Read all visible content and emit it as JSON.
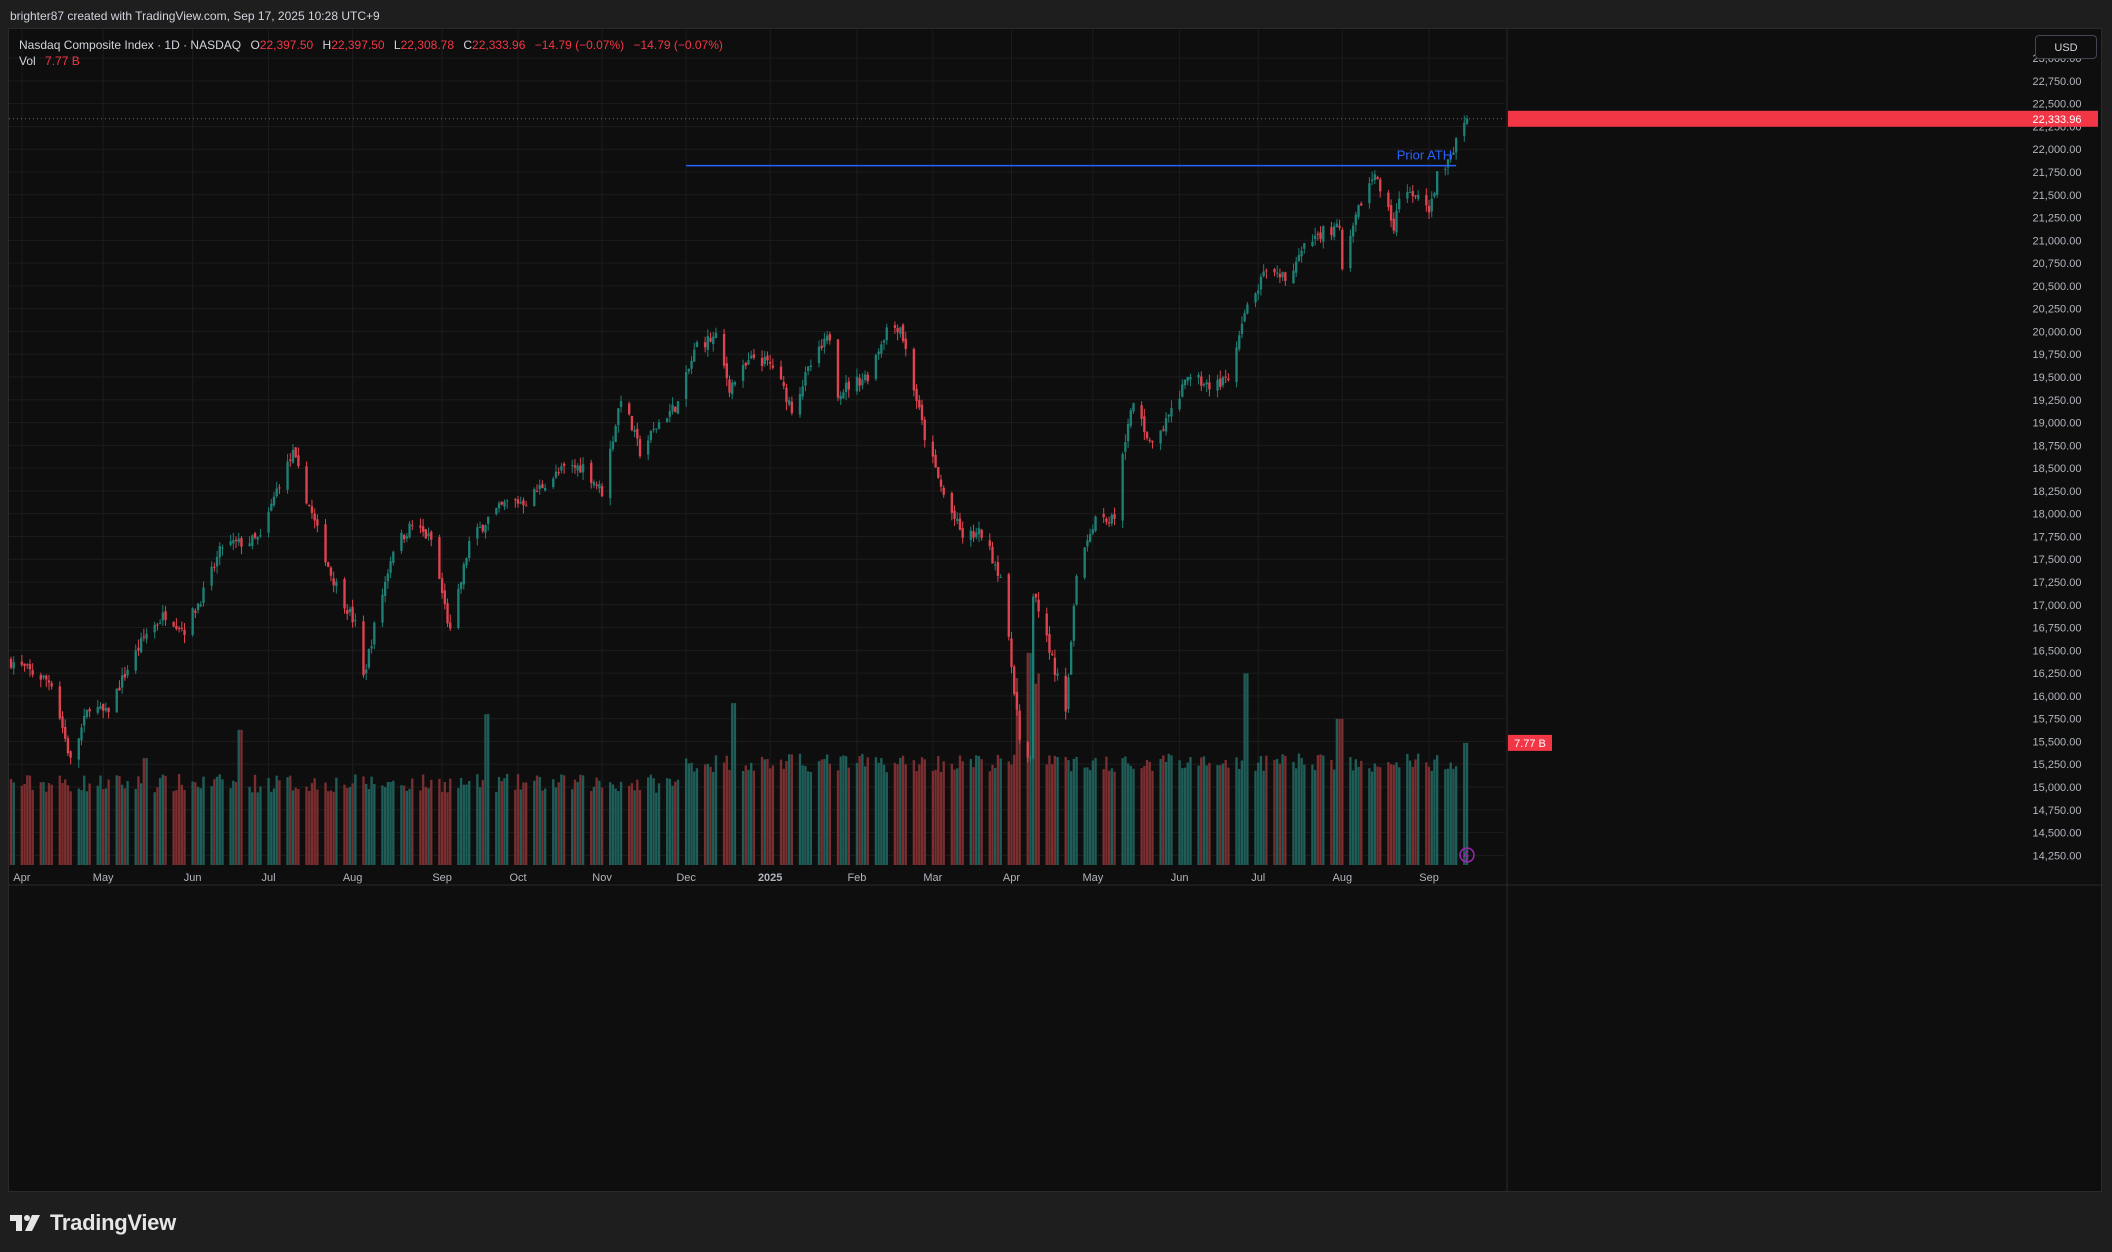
{
  "header": {
    "attribution": "brighter87 created with TradingView.com, Sep 17, 2025 10:28 UTC+9"
  },
  "legend": {
    "symbol": "Nasdaq Composite Index · 1D · NASDAQ",
    "o_label": "O",
    "o_value": "22,397.50",
    "h_label": "H",
    "h_value": "22,397.50",
    "l_label": "L",
    "l_value": "22,308.78",
    "c_label": "C",
    "c_value": "22,333.96",
    "change": "−14.79 (−0.07%)",
    "change_repeat": "−14.79 (−0.07%)",
    "vol_label": "Vol",
    "vol_value": "7.77 B"
  },
  "currency_button": "USD",
  "footer": {
    "logo_text": "TradingView"
  },
  "colors": {
    "up": "#1e7f74",
    "down": "#e04350",
    "vol_up": "#1f5e58",
    "vol_down": "#7a2e30",
    "line": "#2962ff",
    "price_tag": "#f23645",
    "annotation": "#2962ff"
  },
  "chart_data": {
    "type": "candlestick",
    "title": "Nasdaq Composite Index · 1D · NASDAQ",
    "ylim": [
      14100,
      23100
    ],
    "y_ticks": [
      "14,250.00",
      "14,500.00",
      "14,750.00",
      "15,000.00",
      "15,250.00",
      "15,500.00",
      "15,750.00",
      "16,000.00",
      "16,250.00",
      "16,500.00",
      "16,750.00",
      "17,000.00",
      "17,250.00",
      "17,500.00",
      "17,750.00",
      "18,000.00",
      "18,250.00",
      "18,500.00",
      "18,750.00",
      "19,000.00",
      "19,250.00",
      "19,500.00",
      "19,750.00",
      "20,000.00",
      "20,250.00",
      "20,500.00",
      "20,750.00",
      "21,000.00",
      "21,250.00",
      "21,500.00",
      "21,750.00",
      "22,000.00",
      "22,250.00",
      "22,500.00",
      "22,750.00",
      "23,000.00"
    ],
    "x_labels": [
      {
        "label": "Apr",
        "date": "2024-04-01",
        "bold": false
      },
      {
        "label": "May",
        "date": "2024-05-01",
        "bold": false
      },
      {
        "label": "Jun",
        "date": "2024-06-03",
        "bold": false
      },
      {
        "label": "Jul",
        "date": "2024-07-01",
        "bold": false
      },
      {
        "label": "Aug",
        "date": "2024-08-01",
        "bold": false
      },
      {
        "label": "Sep",
        "date": "2024-09-03",
        "bold": false
      },
      {
        "label": "Oct",
        "date": "2024-10-01",
        "bold": false
      },
      {
        "label": "Nov",
        "date": "2024-11-01",
        "bold": false
      },
      {
        "label": "Dec",
        "date": "2024-12-02",
        "bold": false
      },
      {
        "label": "2025",
        "date": "2025-01-02",
        "bold": true
      },
      {
        "label": "Feb",
        "date": "2025-02-03",
        "bold": false
      },
      {
        "label": "Mar",
        "date": "2025-03-03",
        "bold": false
      },
      {
        "label": "Apr",
        "date": "2025-04-01",
        "bold": false
      },
      {
        "label": "May",
        "date": "2025-05-01",
        "bold": false
      },
      {
        "label": "Jun",
        "date": "2025-06-02",
        "bold": false
      },
      {
        "label": "Jul",
        "date": "2025-07-01",
        "bold": false
      },
      {
        "label": "Aug",
        "date": "2025-08-01",
        "bold": false
      },
      {
        "label": "Sep",
        "date": "2025-09-02",
        "bold": false
      }
    ],
    "date_range": [
      "2024-03-28",
      "2025-09-16"
    ],
    "last_price": 22333.96,
    "last_price_label": "22,333.96",
    "volume_label": "7.77 B",
    "horizontal_line": {
      "value": 21820,
      "from": "2024-12-02",
      "to": "2025-09-12",
      "label": "Prior ATH"
    },
    "closes_approx": [
      {
        "date": "2024-03-28",
        "close": 16380
      },
      {
        "date": "2024-04-05",
        "close": 16250
      },
      {
        "date": "2024-04-12",
        "close": 16150
      },
      {
        "date": "2024-04-19",
        "close": 15280
      },
      {
        "date": "2024-04-26",
        "close": 15900
      },
      {
        "date": "2024-05-02",
        "close": 15800
      },
      {
        "date": "2024-05-10",
        "close": 16300
      },
      {
        "date": "2024-05-17",
        "close": 16690
      },
      {
        "date": "2024-05-24",
        "close": 16900
      },
      {
        "date": "2024-05-31",
        "close": 16730
      },
      {
        "date": "2024-06-07",
        "close": 17130
      },
      {
        "date": "2024-06-14",
        "close": 17650
      },
      {
        "date": "2024-06-21",
        "close": 17680
      },
      {
        "date": "2024-06-28",
        "close": 17720
      },
      {
        "date": "2024-07-05",
        "close": 18350
      },
      {
        "date": "2024-07-10",
        "close": 18650
      },
      {
        "date": "2024-07-17",
        "close": 17990
      },
      {
        "date": "2024-07-24",
        "close": 17340
      },
      {
        "date": "2024-08-02",
        "close": 16780
      },
      {
        "date": "2024-08-05",
        "close": 16200
      },
      {
        "date": "2024-08-09",
        "close": 16750
      },
      {
        "date": "2024-08-16",
        "close": 17630
      },
      {
        "date": "2024-08-23",
        "close": 17880
      },
      {
        "date": "2024-08-30",
        "close": 17710
      },
      {
        "date": "2024-09-06",
        "close": 16690
      },
      {
        "date": "2024-09-13",
        "close": 17680
      },
      {
        "date": "2024-09-20",
        "close": 17950
      },
      {
        "date": "2024-09-27",
        "close": 18120
      },
      {
        "date": "2024-10-04",
        "close": 18140
      },
      {
        "date": "2024-10-11",
        "close": 18340
      },
      {
        "date": "2024-10-18",
        "close": 18490
      },
      {
        "date": "2024-10-25",
        "close": 18520
      },
      {
        "date": "2024-11-01",
        "close": 18240
      },
      {
        "date": "2024-11-08",
        "close": 19290
      },
      {
        "date": "2024-11-15",
        "close": 18680
      },
      {
        "date": "2024-11-22",
        "close": 19000
      },
      {
        "date": "2024-11-29",
        "close": 19210
      },
      {
        "date": "2024-12-06",
        "close": 19860
      },
      {
        "date": "2024-12-13",
        "close": 19930
      },
      {
        "date": "2024-12-18",
        "close": 19390
      },
      {
        "date": "2024-12-27",
        "close": 19720
      },
      {
        "date": "2025-01-03",
        "close": 19620
      },
      {
        "date": "2025-01-10",
        "close": 19160
      },
      {
        "date": "2025-01-17",
        "close": 19630
      },
      {
        "date": "2025-01-24",
        "close": 19950
      },
      {
        "date": "2025-01-27",
        "close": 19340
      },
      {
        "date": "2025-02-07",
        "close": 19520
      },
      {
        "date": "2025-02-14",
        "close": 20030
      },
      {
        "date": "2025-02-19",
        "close": 20060
      },
      {
        "date": "2025-02-28",
        "close": 18850
      },
      {
        "date": "2025-03-07",
        "close": 18200
      },
      {
        "date": "2025-03-14",
        "close": 17750
      },
      {
        "date": "2025-03-21",
        "close": 17780
      },
      {
        "date": "2025-03-28",
        "close": 17320
      },
      {
        "date": "2025-04-04",
        "close": 15590
      },
      {
        "date": "2025-04-08",
        "close": 15270
      },
      {
        "date": "2025-04-09",
        "close": 17120
      },
      {
        "date": "2025-04-17",
        "close": 16290
      },
      {
        "date": "2025-04-21",
        "close": 15870
      },
      {
        "date": "2025-04-25",
        "close": 17380
      },
      {
        "date": "2025-05-02",
        "close": 17980
      },
      {
        "date": "2025-05-09",
        "close": 17930
      },
      {
        "date": "2025-05-12",
        "close": 18710
      },
      {
        "date": "2025-05-16",
        "close": 19210
      },
      {
        "date": "2025-05-23",
        "close": 18740
      },
      {
        "date": "2025-05-30",
        "close": 19110
      },
      {
        "date": "2025-06-06",
        "close": 19530
      },
      {
        "date": "2025-06-13",
        "close": 19410
      },
      {
        "date": "2025-06-20",
        "close": 19450
      },
      {
        "date": "2025-06-27",
        "close": 20270
      },
      {
        "date": "2025-07-03",
        "close": 20600
      },
      {
        "date": "2025-07-11",
        "close": 20590
      },
      {
        "date": "2025-07-18",
        "close": 20900
      },
      {
        "date": "2025-07-25",
        "close": 21110
      },
      {
        "date": "2025-07-31",
        "close": 21120
      },
      {
        "date": "2025-08-01",
        "close": 20650
      },
      {
        "date": "2025-08-08",
        "close": 21450
      },
      {
        "date": "2025-08-13",
        "close": 21710
      },
      {
        "date": "2025-08-20",
        "close": 21170
      },
      {
        "date": "2025-08-22",
        "close": 21500
      },
      {
        "date": "2025-08-29",
        "close": 21460
      },
      {
        "date": "2025-09-02",
        "close": 21280
      },
      {
        "date": "2025-09-05",
        "close": 21700
      },
      {
        "date": "2025-09-10",
        "close": 21890
      },
      {
        "date": "2025-09-12",
        "close": 22140
      },
      {
        "date": "2025-09-16",
        "close": 22333.96
      }
    ],
    "volume_peaks_approx": [
      {
        "date": "2024-05-17",
        "volume_b": 6.8
      },
      {
        "date": "2024-06-21",
        "volume_b": 8.6
      },
      {
        "date": "2024-09-20",
        "volume_b": 9.6
      },
      {
        "date": "2024-12-20",
        "volume_b": 10.3
      },
      {
        "date": "2025-04-07",
        "volume_b": 13.5
      },
      {
        "date": "2025-06-27",
        "volume_b": 12.2
      },
      {
        "date": "2025-07-31",
        "volume_b": 9.3
      },
      {
        "date": "2025-09-16",
        "volume_b": 7.77
      }
    ]
  }
}
